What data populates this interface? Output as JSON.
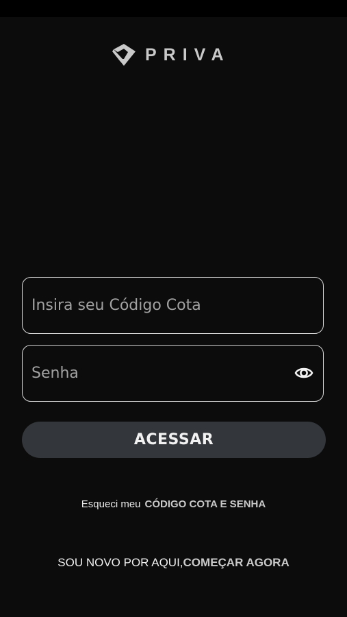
{
  "brand": {
    "logo_icon": "priva-diamond-logo",
    "name": "PRIVA"
  },
  "login": {
    "code_field": {
      "placeholder": "Insira seu Código Cota",
      "value": ""
    },
    "password_field": {
      "placeholder": "Senha",
      "value": "",
      "toggle_icon": "eye-icon"
    },
    "submit_label": "ACESSAR"
  },
  "forgot": {
    "text": "Esqueci meu",
    "link": "CÓDIGO COTA E SENHA"
  },
  "signup": {
    "text": "SOU NOVO POR AQUI,",
    "link": "COMEÇAR AGORA"
  },
  "colors": {
    "background": "#0c0c0c",
    "button": "#33363a",
    "field_border": "#d9d9d9",
    "link": "#c9c9c9"
  }
}
